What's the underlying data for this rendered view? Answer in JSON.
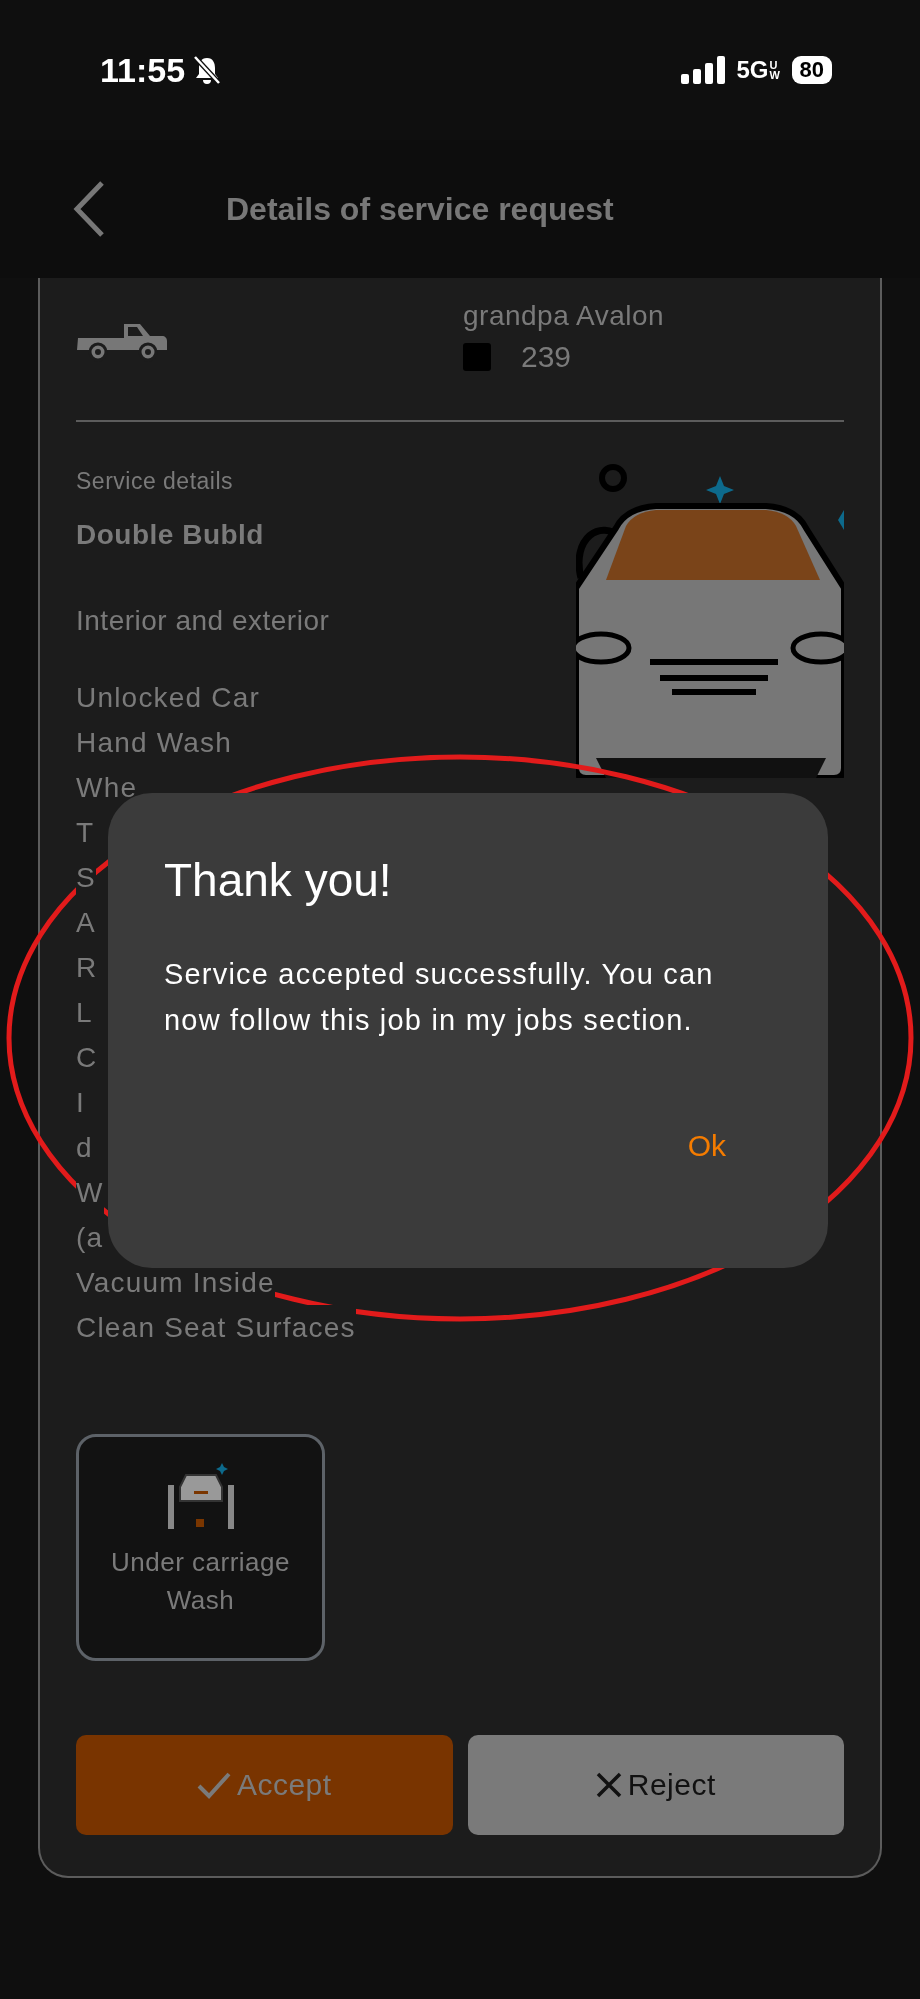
{
  "status_bar": {
    "time": "11:55",
    "network": "5G",
    "network_sub": "UW",
    "battery": "80"
  },
  "header": {
    "title": "Details of service request"
  },
  "vehicle": {
    "name": "grandpa Avalon",
    "color": "#000000",
    "plate": "239"
  },
  "service": {
    "section_label": "Service details",
    "package": "Double Bubld",
    "scope": "Interior and exterior",
    "items": [
      "Unlocked Car",
      "Hand Wash",
      "Whe",
      "T",
      "S",
      "A",
      "R",
      "L",
      "C",
      "I",
      "d",
      "W",
      "(a",
      "Vacuum Inside",
      "Clean Seat Surfaces"
    ]
  },
  "addons": [
    {
      "label": "Under carriage Wash"
    }
  ],
  "actions": [
    {
      "kind": "accept",
      "label": "Accept"
    },
    {
      "kind": "reject",
      "label": "Reject"
    }
  ],
  "dialog": {
    "title": "Thank you!",
    "message": "Service accepted successfully. You can now follow this job in my jobs section.",
    "button": "Ok"
  }
}
